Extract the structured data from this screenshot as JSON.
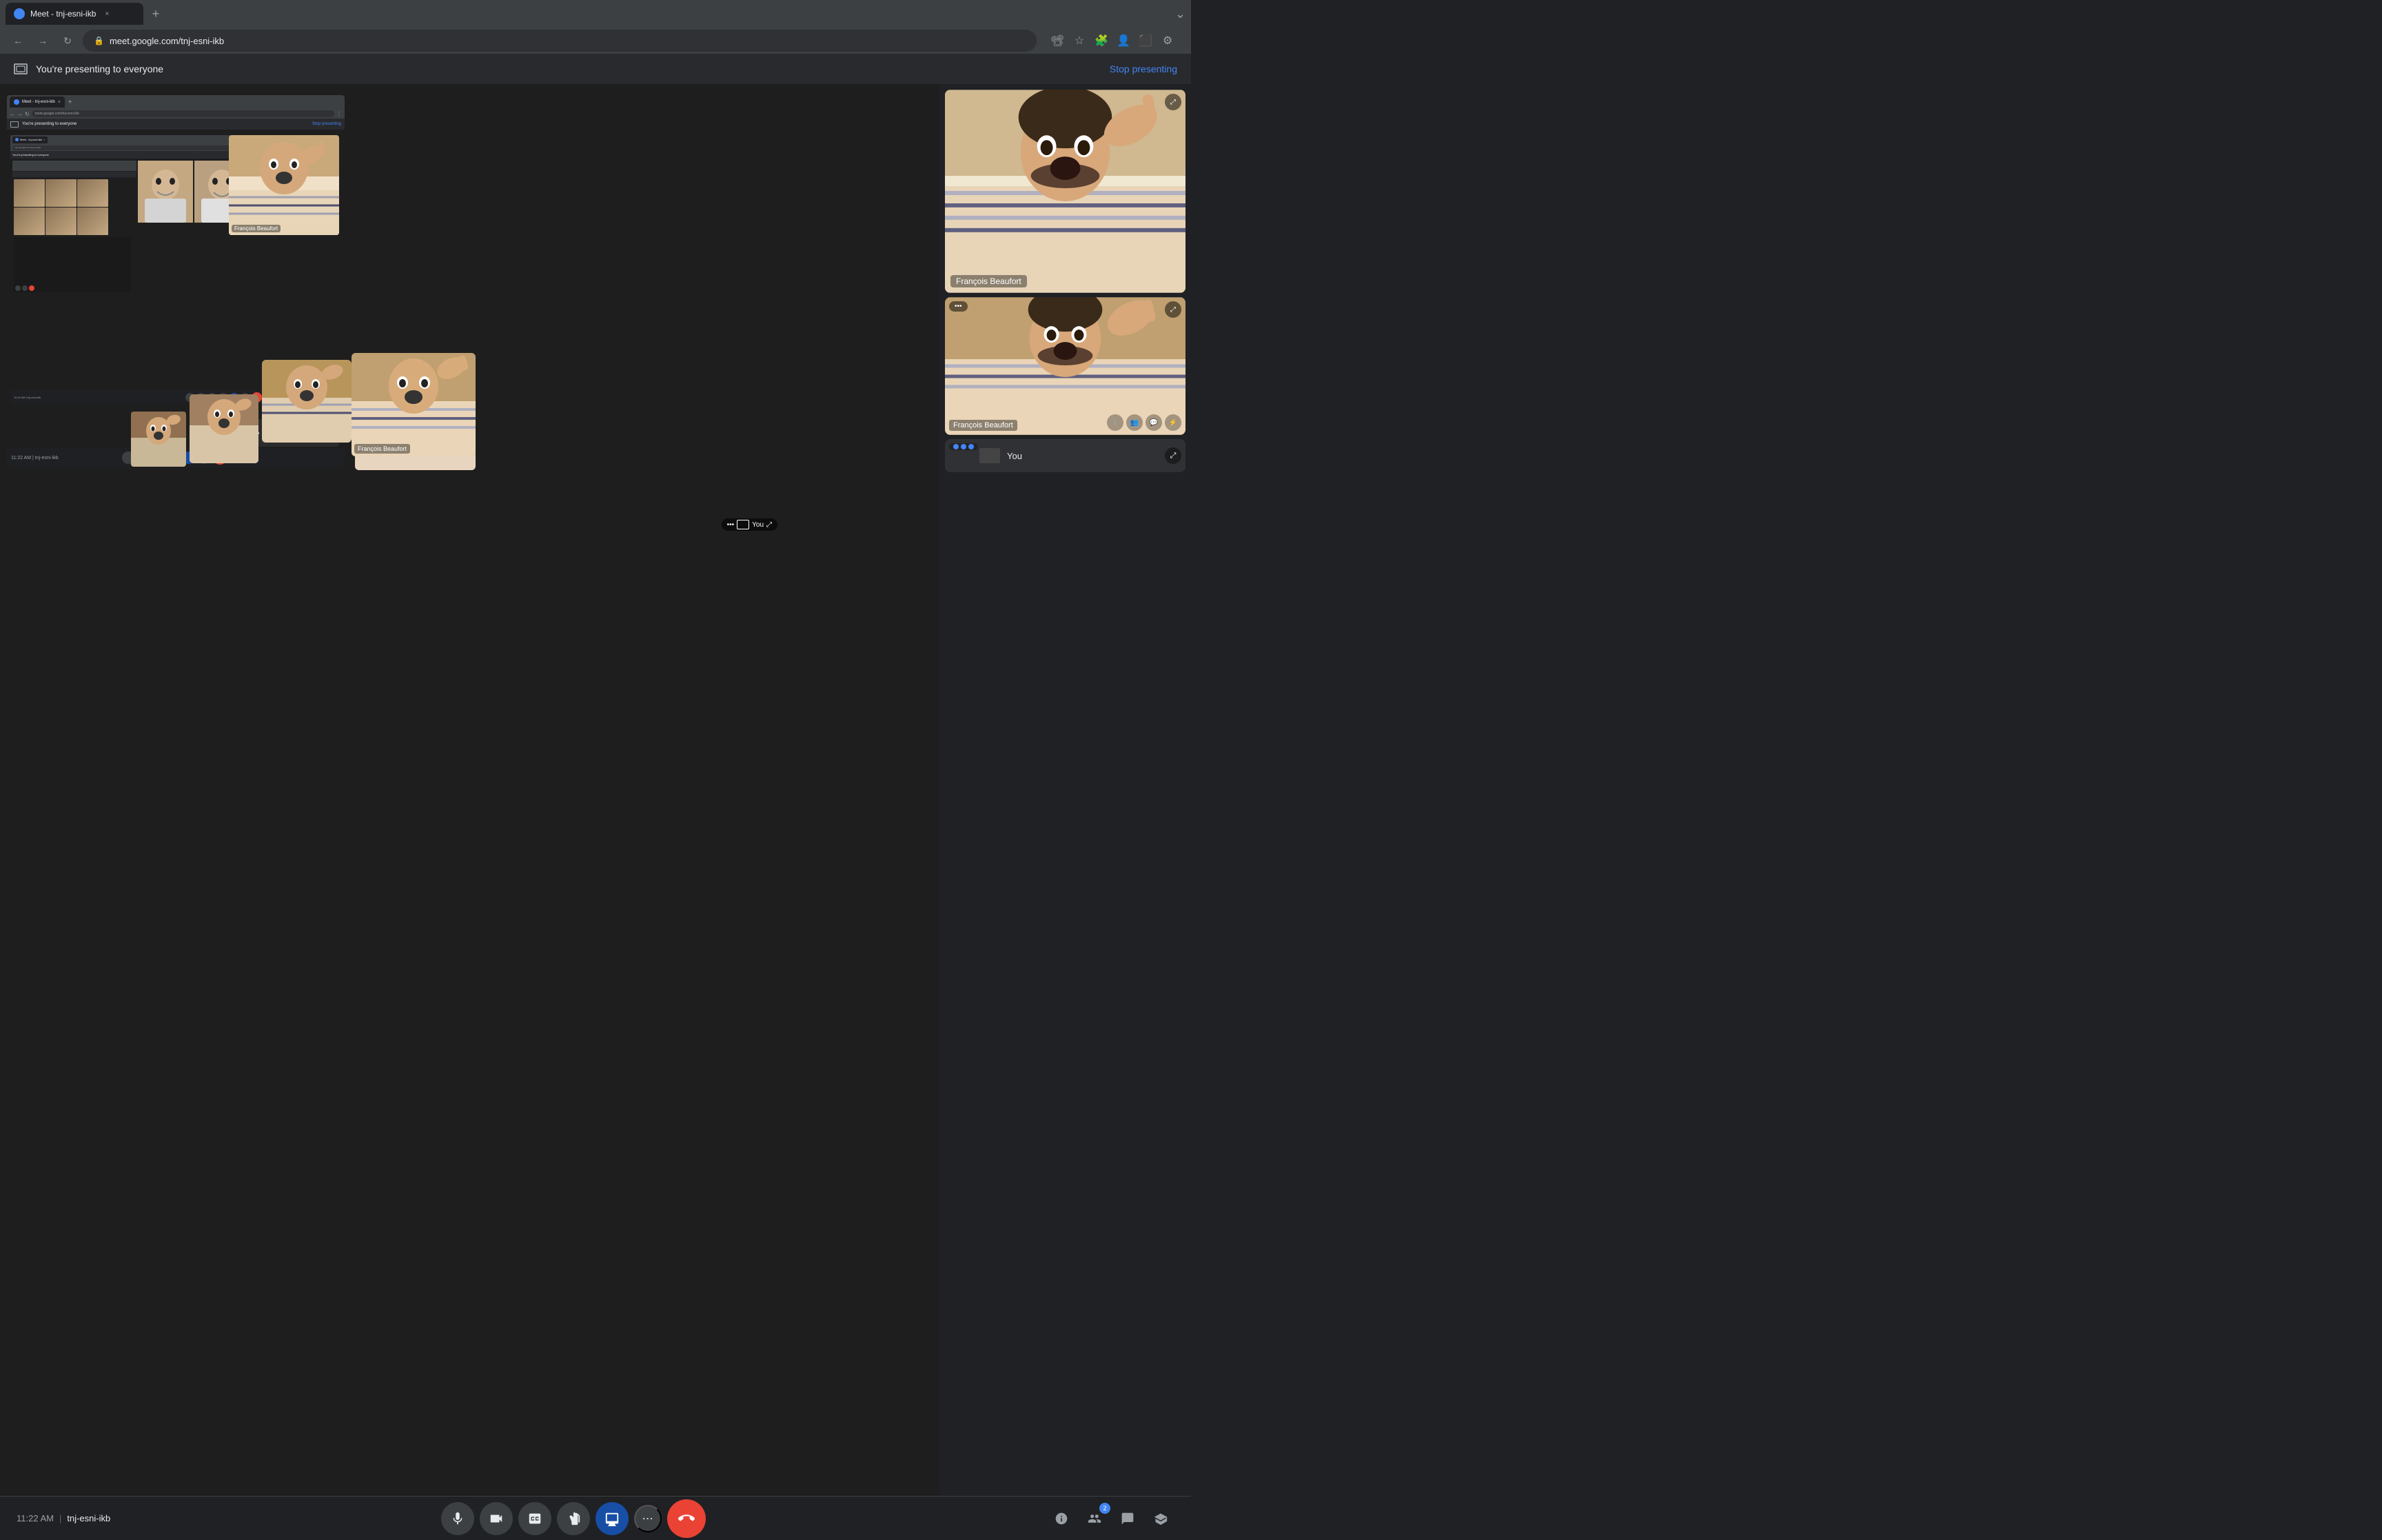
{
  "browser": {
    "tab_title": "Meet - tnj-esni-ikb",
    "tab_close": "×",
    "tab_new": "+",
    "nav_back": "←",
    "nav_forward": "→",
    "nav_refresh": "↻",
    "url": "meet.google.com/tnj-esni-ikb",
    "more_menu": "⋮"
  },
  "sharing_banner": {
    "icon": "⬡",
    "text": "You're presenting to everyone",
    "stop_btn": "Stop presenting"
  },
  "nested_browser": {
    "tab_title": "Meet - tnj-esni-ikb",
    "url": "meet.google.com/tnj-esni-ikb",
    "sharing_text": "You're presenting to everyone",
    "stop_btn": "Stop presenting"
  },
  "participants": {
    "francois": {
      "name": "François Beaufort",
      "label": "François Beaufort"
    },
    "you": {
      "name": "You",
      "label": "You"
    }
  },
  "bottom_bar": {
    "time": "11:22 AM",
    "meeting_code": "tnj-esni-ikb",
    "divider": "|",
    "mic_icon": "🎙",
    "camera_icon": "📷",
    "captions_icon": "CC",
    "effects_icon": "✋",
    "present_icon": "⬡",
    "more_icon": "⋮",
    "end_icon": "📞",
    "info_icon": "ℹ",
    "people_icon": "👥",
    "chat_icon": "💬",
    "activities_icon": "⚡"
  },
  "tile_controls": {
    "more": "•••",
    "expand": "⤢",
    "window": "▭"
  },
  "right_panel_bottom": {
    "you_label": "You"
  },
  "meeting": {
    "time": "11:22 AM",
    "code": "tnj-esni-ikb"
  }
}
